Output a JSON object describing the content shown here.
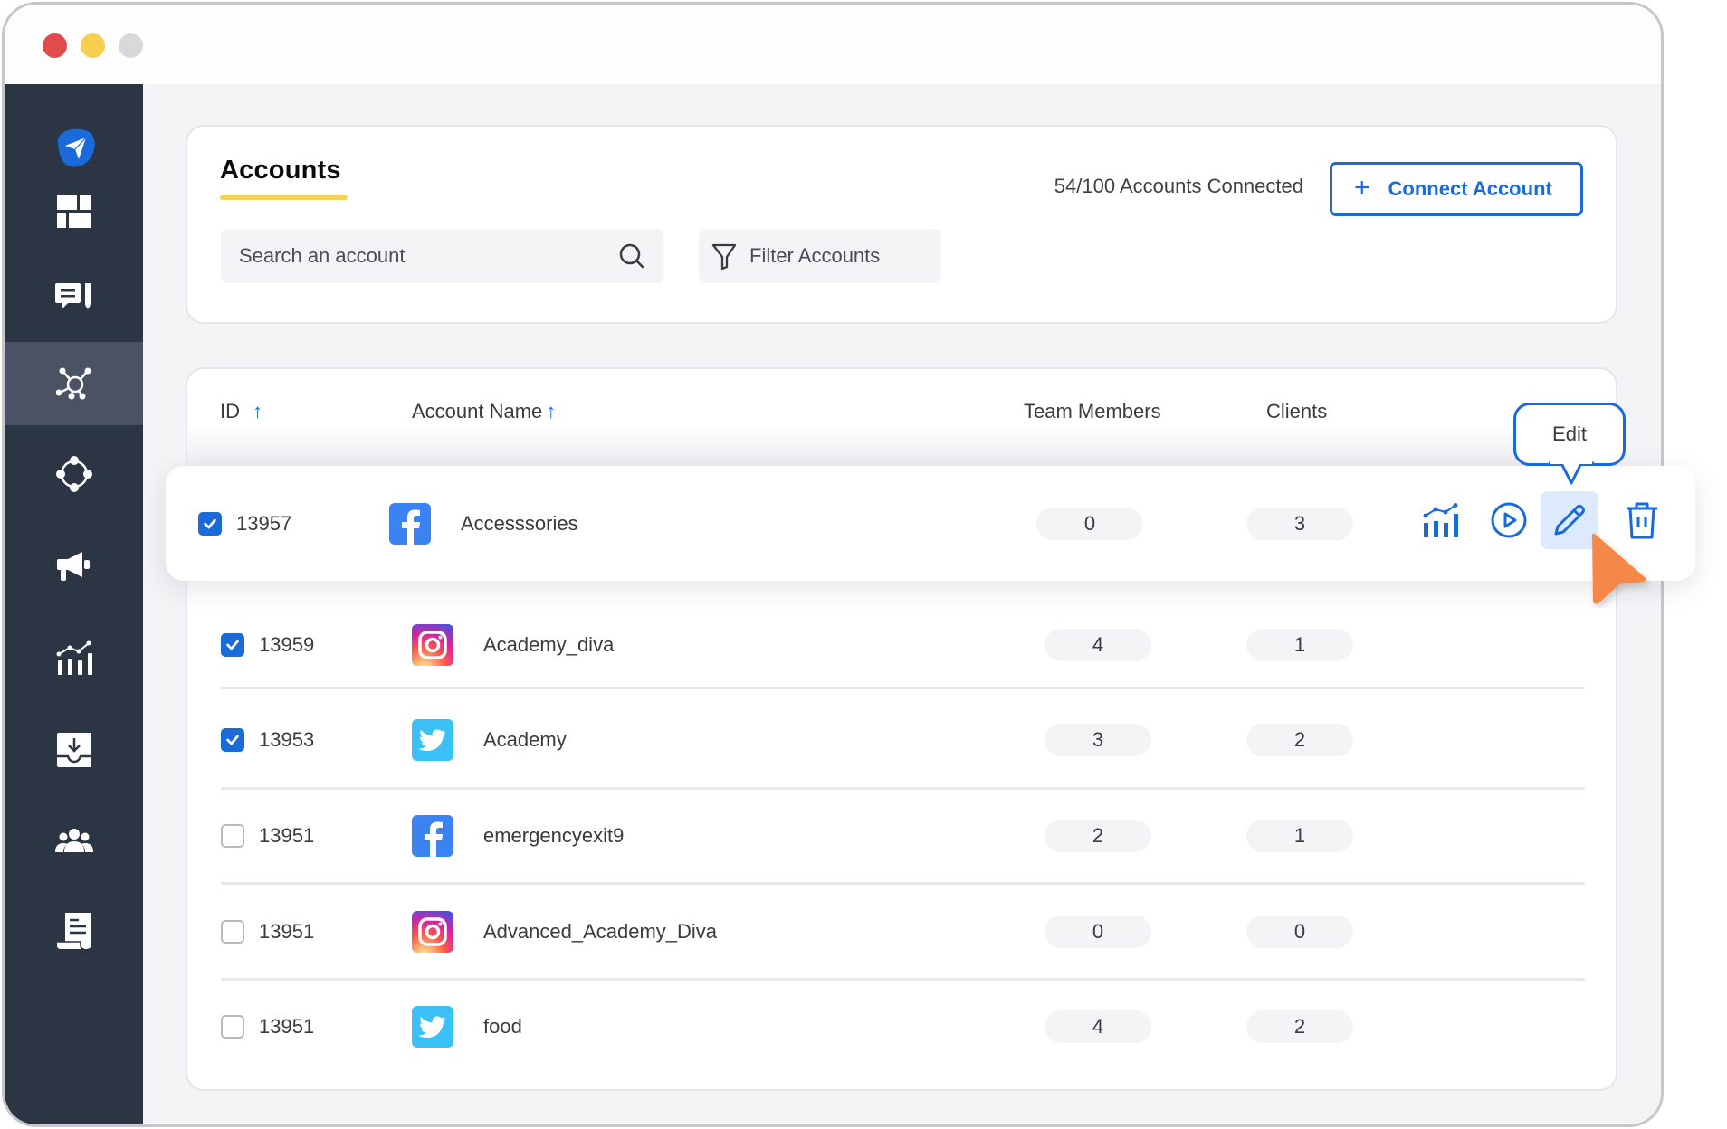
{
  "window": {
    "traffic_lights": [
      "close",
      "minimize",
      "zoom"
    ]
  },
  "sidebar": {
    "items": [
      {
        "name": "logo",
        "icon": "paper-plane-icon",
        "active": false
      },
      {
        "name": "dashboard",
        "icon": "dashboard-grid-icon",
        "active": false
      },
      {
        "name": "compose",
        "icon": "comment-pencil-icon",
        "active": false
      },
      {
        "name": "accounts",
        "icon": "network-hub-icon",
        "active": true
      },
      {
        "name": "connections",
        "icon": "circle-nodes-icon",
        "active": false
      },
      {
        "name": "campaigns",
        "icon": "megaphone-icon",
        "active": false
      },
      {
        "name": "analytics",
        "icon": "chart-bars-icon",
        "active": false
      },
      {
        "name": "inbox",
        "icon": "inbox-download-icon",
        "active": false
      },
      {
        "name": "team",
        "icon": "users-group-icon",
        "active": false
      },
      {
        "name": "reports",
        "icon": "document-scroll-icon",
        "active": false
      }
    ]
  },
  "header": {
    "title": "Accounts",
    "search_placeholder": "Search an account",
    "search_value": "",
    "filter_label": "Filter Accounts",
    "connected_count": "54/100 Accounts Connected",
    "connect_button_label": "Connect Account",
    "connect_button_icon": "+"
  },
  "table": {
    "columns": [
      {
        "label": "ID",
        "sort": "asc"
      },
      {
        "label": "Account Name",
        "sort": "asc"
      },
      {
        "label": "Team Members"
      },
      {
        "label": "Clients"
      }
    ],
    "sort_arrow": "↑",
    "rows": [
      {
        "checked": true,
        "id": "13957",
        "platform": "facebook",
        "name": "Accesssories",
        "team_members": "0",
        "clients": "3",
        "highlighted": true
      },
      {
        "checked": true,
        "id": "13959",
        "platform": "instagram",
        "name": "Academy_diva",
        "team_members": "4",
        "clients": "1"
      },
      {
        "checked": true,
        "id": "13953",
        "platform": "twitter",
        "name": "Academy",
        "team_members": "3",
        "clients": "2"
      },
      {
        "checked": false,
        "id": "13951",
        "platform": "facebook",
        "name": "emergencyexit9",
        "team_members": "2",
        "clients": "1"
      },
      {
        "checked": false,
        "id": "13951",
        "platform": "instagram",
        "name": "Advanced_Academy_Diva",
        "team_members": "0",
        "clients": "0"
      },
      {
        "checked": false,
        "id": "13951",
        "platform": "twitter",
        "name": "food",
        "team_members": "4",
        "clients": "2"
      }
    ],
    "row_actions": [
      "analytics",
      "play",
      "edit",
      "delete"
    ],
    "tooltip": "Edit"
  },
  "colors": {
    "accent": "#1a6ad9",
    "sidebar_bg": "#2c3544",
    "sidebar_active": "#4a5263",
    "title_underline": "#f3d257",
    "cursor": "#f5874a",
    "facebook": "#3b82f2",
    "twitter": "#3bc1f5"
  }
}
